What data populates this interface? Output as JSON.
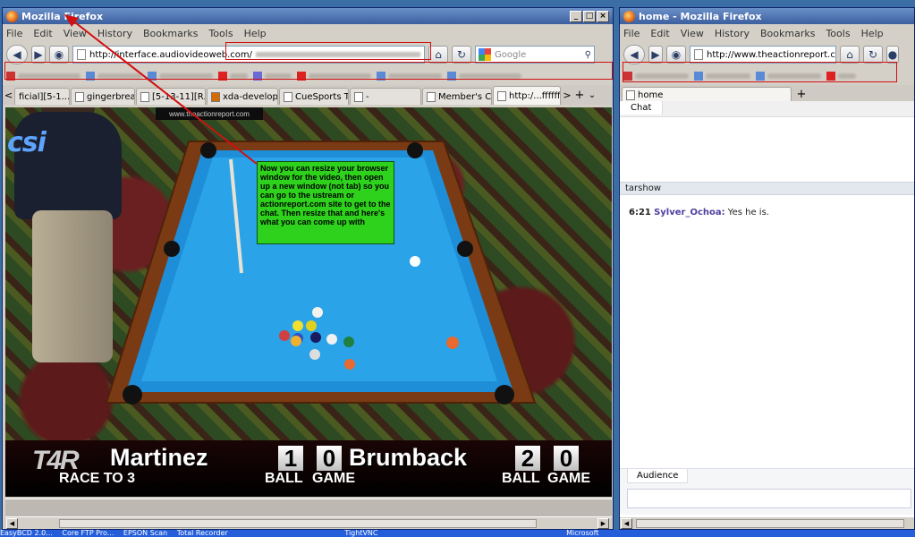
{
  "left_window": {
    "title": "Mozilla Firefox",
    "window_buttons": [
      "_",
      "□",
      "×"
    ],
    "menu": [
      "File",
      "Edit",
      "View",
      "History",
      "Bookmarks",
      "Tools",
      "Help"
    ],
    "url": "http://interface.audiovideoweb.com/",
    "search_placeholder": "Google",
    "tabs": [
      {
        "label": "ficial][5-1...",
        "active": false
      },
      {
        "label": "gingerbread-...",
        "active": false
      },
      {
        "label": "[5-13-11][R...",
        "active": false
      },
      {
        "label": "xda-develop...",
        "active": false
      },
      {
        "label": "CueSports T...",
        "active": false
      },
      {
        "label": "-",
        "active": false
      },
      {
        "label": "Member's Ca...",
        "active": false
      },
      {
        "label": "http:/...ffffff",
        "active": true
      }
    ],
    "tab_controls": [
      "<",
      ">",
      "+",
      "⌄"
    ]
  },
  "video": {
    "logo": "csi",
    "banner": "www.theactionreport.com",
    "overlay_brand": "T4R",
    "player1": {
      "name": "Martinez",
      "ball": "1",
      "game": "0"
    },
    "player2": {
      "name": "Brumback",
      "ball": "2",
      "game": "0"
    },
    "race": "RACE TO 3",
    "label_ball": "BALL",
    "label_game": "GAME",
    "note": "Now you can resize your browser window for the video, then open up a new window (not tab) so you can go to the ustream or actionreport.com site to get to the chat.  Then resize that and here's what you can come up with"
  },
  "right_window": {
    "title": "home - Mozilla Firefox",
    "window_buttons": [
      "_",
      "□",
      "×"
    ],
    "menu": [
      "File",
      "Edit",
      "View",
      "History",
      "Bookmarks",
      "Tools",
      "Help"
    ],
    "url": "http://www.theactionreport.c",
    "tab_label": "home",
    "new_tab": "+",
    "chat_tab": "Chat",
    "room_name": "tarshow",
    "messages": [
      {
        "time": "6:21",
        "user": "Sylver_Ochoa:",
        "text": "Yes he is."
      }
    ],
    "audience_label": "Audience"
  },
  "taskbar": [
    "EasyBCD 2.0...",
    "Core FTP Pro...",
    "EPSON Scan",
    "Total Recorder",
    "TightVNC",
    "Microsoft"
  ],
  "colors": {
    "accent_red": "#d01010",
    "note_green": "#2ed11c",
    "felt_blue": "#2aa3e8",
    "username": "#4f3e9e"
  }
}
